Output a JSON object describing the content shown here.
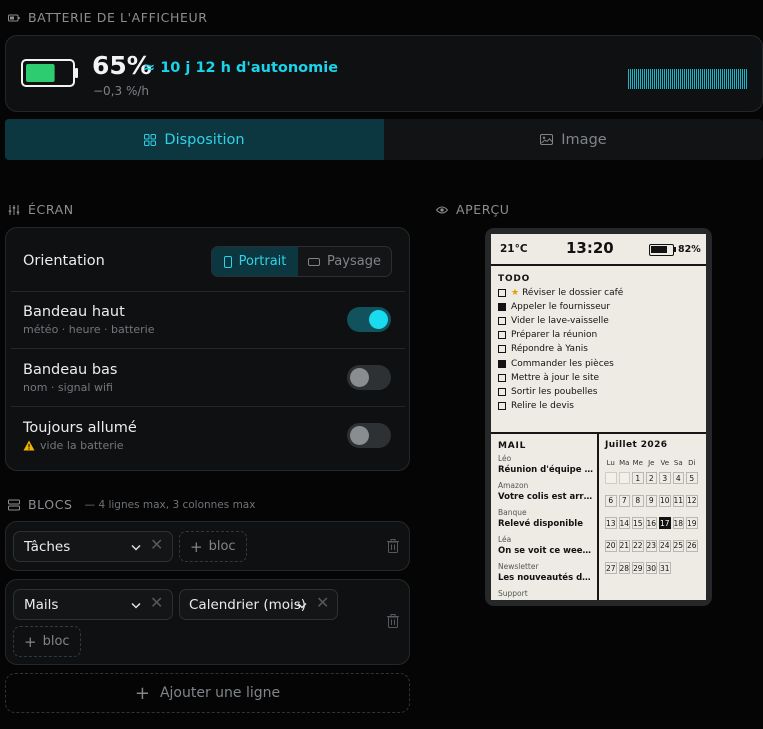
{
  "battery": {
    "section_title": "BATTERIE DE L'AFFICHEUR",
    "percent": "65%",
    "level": 0.65,
    "autonomy": "≈ 10 j 12 h d'autonomie",
    "rate": "−0,3 %/h",
    "colors": {
      "fill": "#2ecc71",
      "accent": "#19d4ea"
    }
  },
  "tabs": [
    {
      "label": "Disposition",
      "icon": "grid-icon",
      "active": true
    },
    {
      "label": "Image",
      "icon": "image-icon",
      "active": false
    }
  ],
  "screen": {
    "section_title": "ÉCRAN",
    "orientation": {
      "label": "Orientation",
      "options": [
        "Portrait",
        "Paysage"
      ],
      "selected": "Portrait"
    },
    "toggles": [
      {
        "label": "Bandeau haut",
        "sub": "météo · heure · batterie",
        "on": true
      },
      {
        "label": "Bandeau bas",
        "sub": "nom · signal wifi",
        "on": false
      },
      {
        "label": "Toujours allumé",
        "sub": "vide la batterie",
        "on": false,
        "warning": true
      }
    ]
  },
  "blocks": {
    "section_title": "BLOCS",
    "section_note": "— 4 lignes max, 3 colonnes max",
    "rows": [
      {
        "items": [
          "Tâches"
        ],
        "add_label": "bloc"
      },
      {
        "items": [
          "Mails",
          "Calendrier (mois)"
        ],
        "add_label": "bloc"
      }
    ],
    "add_line_label": "Ajouter une ligne"
  },
  "preview": {
    "section_title": "APERÇU",
    "status": {
      "temp": "21°C",
      "time": "13:20",
      "battery": "82%",
      "battery_level": 0.82
    },
    "todo": {
      "title": "TODO",
      "items": [
        {
          "text": "Réviser le dossier café",
          "done": false,
          "star": true
        },
        {
          "text": "Appeler le fournisseur",
          "done": true,
          "star": false
        },
        {
          "text": "Vider le lave-vaisselle",
          "done": false,
          "star": false
        },
        {
          "text": "Préparer la réunion",
          "done": false,
          "star": false
        },
        {
          "text": "Répondre à Yanis",
          "done": false,
          "star": false
        },
        {
          "text": "Commander les pièces",
          "done": true,
          "star": false
        },
        {
          "text": "Mettre à jour le site",
          "done": false,
          "star": false
        },
        {
          "text": "Sortir les poubelles",
          "done": false,
          "star": false
        },
        {
          "text": "Relire le devis",
          "done": false,
          "star": false
        }
      ]
    },
    "mail": {
      "title": "MAIL",
      "items": [
        {
          "from": "Léo",
          "subject": "Réunion d'équipe l..."
        },
        {
          "from": "Amazon",
          "subject": "Votre colis est arrivé"
        },
        {
          "from": "Banque",
          "subject": "Relevé disponible"
        },
        {
          "from": "Léa",
          "subject": "On se voit ce week..."
        },
        {
          "from": "Newsletter",
          "subject": "Les nouveautés du ..."
        },
        {
          "from": "Support",
          "subject": ""
        }
      ]
    },
    "calendar": {
      "title": "Juillet 2026",
      "day_names": [
        "Lu",
        "Ma",
        "Me",
        "Je",
        "Ve",
        "Sa",
        "Di"
      ],
      "weeks": [
        [
          "",
          "",
          "1",
          "2",
          "3",
          "4",
          "5"
        ],
        [
          "6",
          "7",
          "8",
          "9",
          "10",
          "11",
          "12"
        ],
        [
          "13",
          "14",
          "15",
          "16",
          "17",
          "18",
          "19"
        ],
        [
          "20",
          "21",
          "22",
          "23",
          "24",
          "25",
          "26"
        ],
        [
          "27",
          "28",
          "29",
          "30",
          "31"
        ]
      ],
      "today": "17"
    }
  }
}
